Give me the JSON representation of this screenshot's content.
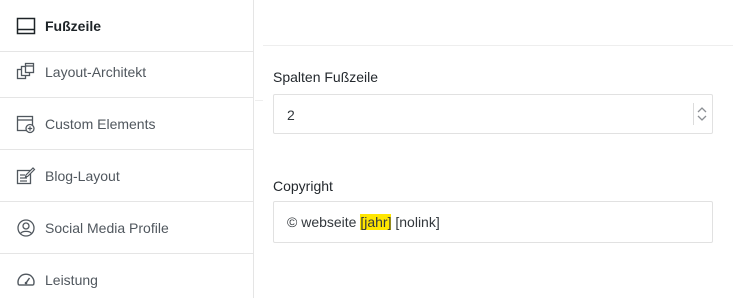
{
  "sidebar": {
    "items": [
      {
        "label": "Fußzeile",
        "icon": "footer-layout-icon",
        "active": true
      },
      {
        "label": "Layout-Architekt",
        "icon": "layout-builder-icon",
        "active": false
      },
      {
        "label": "Custom Elements",
        "icon": "custom-elements-icon",
        "active": false
      },
      {
        "label": "Blog-Layout",
        "icon": "blog-edit-icon",
        "active": false
      },
      {
        "label": "Social Media Profile",
        "icon": "user-profile-icon",
        "active": false
      },
      {
        "label": "Leistung",
        "icon": "speedometer-icon",
        "active": false
      }
    ]
  },
  "main": {
    "columns": {
      "label": "Spalten Fußzeile",
      "value": "2"
    },
    "copyright": {
      "label": "Copyright",
      "text_before": "© webseite ",
      "shortcode_year": "[jahr]",
      "text_between": " ",
      "shortcode_nolink": "[nolink]"
    }
  },
  "colors": {
    "highlight": "#ffe600",
    "border": "#e1e1e1"
  }
}
